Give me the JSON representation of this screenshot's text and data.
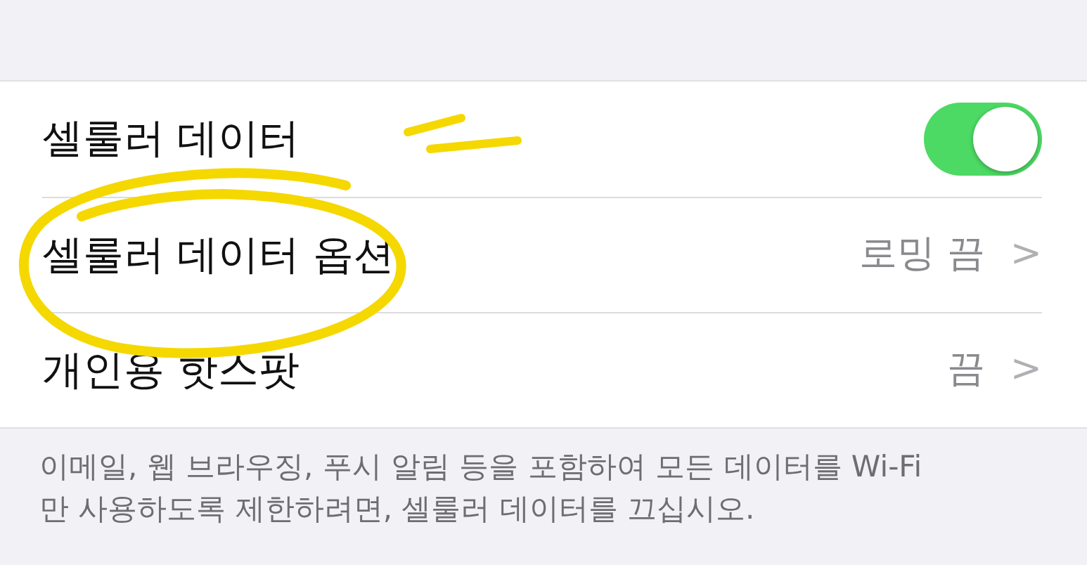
{
  "rows": [
    {
      "kind": "toggle",
      "label": "셀룰러 데이터",
      "on": true
    },
    {
      "kind": "disclosure",
      "label": "셀룰러 데이터 옵션",
      "value": "로밍 끔",
      "chevron": ">"
    },
    {
      "kind": "disclosure",
      "label": "개인용 핫스팟",
      "value": "끔",
      "chevron": ">"
    }
  ],
  "footer": "이메일, 웹 브라우징, 푸시 알림 등을 포함하여 모든 데이터를 Wi-Fi만 사용하도록 제한하려면, 셀룰러 데이터를 끄십시오."
}
